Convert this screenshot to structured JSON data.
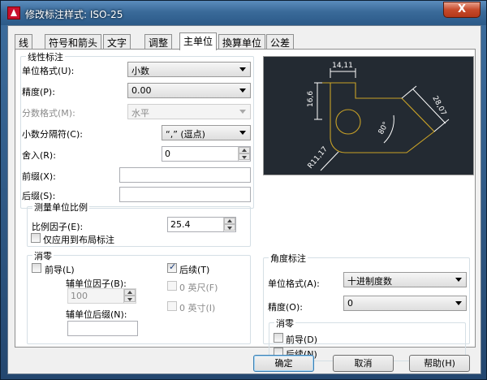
{
  "window": {
    "title": "修改标注样式: ISO-25",
    "close_label": "X"
  },
  "tabs": [
    {
      "label": "线"
    },
    {
      "label": "符号和箭头"
    },
    {
      "label": "文字"
    },
    {
      "label": "调整"
    },
    {
      "label": "主单位"
    },
    {
      "label": "換算单位"
    },
    {
      "label": "公差"
    }
  ],
  "linear": {
    "title": "线性标注",
    "unit_format_label": "单位格式(U):",
    "unit_format_value": "小数",
    "precision_label": "精度(P):",
    "precision_value": "0.00",
    "fraction_label": "分数格式(M):",
    "fraction_value": "水平",
    "decimal_sep_label": "小数分隔符(C):",
    "decimal_sep_value": "“,” (逗点)",
    "roundoff_label": "舍入(R):",
    "roundoff_value": "0",
    "prefix_label": "前缀(X):",
    "prefix_value": "",
    "suffix_label": "后缀(S):",
    "suffix_value": ""
  },
  "scale": {
    "title": "测量单位比例",
    "factor_label": "比例因子(E):",
    "factor_value": "25.4",
    "layout_only_label": "仅应用到布局标注"
  },
  "zero": {
    "title": "消零",
    "leading_label": "前导(L)",
    "trailing_label": "后续(T)",
    "sub_factor_label": "辅单位因子(B):",
    "sub_factor_value": "100",
    "sub_suffix_label": "辅单位后缀(N):",
    "sub_suffix_value": "",
    "feet_label": "0 英尺(F)",
    "inch_label": "0 英寸(I)"
  },
  "angular": {
    "title": "角度标注",
    "unit_format_label": "单位格式(A):",
    "unit_format_value": "十进制度数",
    "precision_label": "精度(O):",
    "precision_value": "0",
    "zero_title": "消零",
    "leading_label": "前导(D)",
    "trailing_label": "后续(N)"
  },
  "preview": {
    "dim_top": "14,11",
    "dim_left": "16,6",
    "dim_right": "28,07",
    "dim_angle": "80°",
    "dim_radius": "R11,17",
    "line_color": "#c9a227",
    "bg_color": "#232a32"
  },
  "buttons": {
    "ok": "确定",
    "cancel": "取消",
    "help": "帮助(H)"
  }
}
